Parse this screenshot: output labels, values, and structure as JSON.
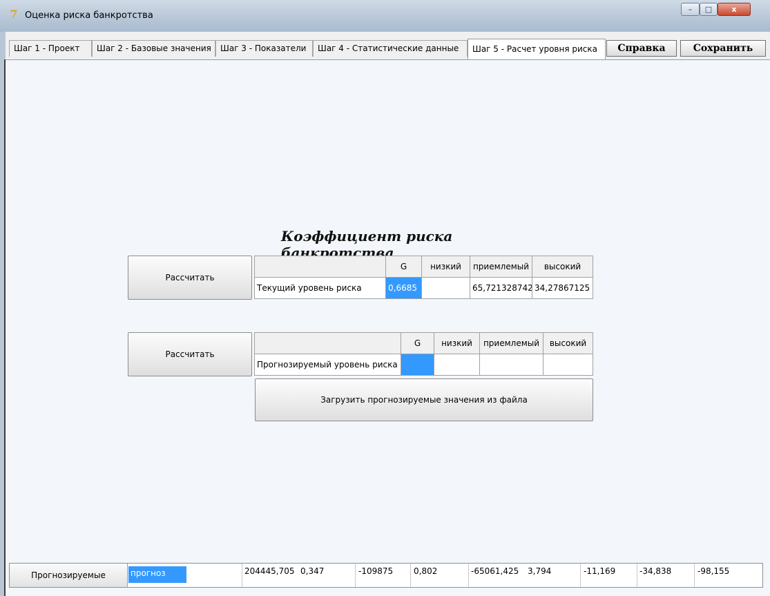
{
  "window": {
    "title": "Оценка риска банкротства",
    "icon": "app-logo-icon",
    "controls": {
      "minimize": "–",
      "maximize": "□",
      "close": "x"
    }
  },
  "tabs": [
    {
      "label": "Шаг 1 - Проект",
      "active": false
    },
    {
      "label": "Шаг 2 - Базовые значения",
      "active": false
    },
    {
      "label": "Шаг 3 - Показатели",
      "active": false
    },
    {
      "label": "Шаг 4 - Статистические данные",
      "active": false
    },
    {
      "label": "Шаг 5 - Расчет уровня риска",
      "active": true
    }
  ],
  "toolbar": {
    "help_label": "Справка",
    "save_label": "Сохранить"
  },
  "main": {
    "heading": "Коэффициент риска банкротства",
    "current": {
      "calc_label": "Рассчитать",
      "headers": [
        "",
        "G",
        "низкий",
        "приемлемый",
        "высокий"
      ],
      "row": [
        "Текущий уровень риска",
        "0,6685",
        "",
        "65,721328742",
        "34,27867125"
      ]
    },
    "forecast": {
      "calc_label": "Рассчитать",
      "headers": [
        "",
        "G",
        "низкий",
        "приемлемый",
        "высокий"
      ],
      "row": [
        "Прогнозируемый уровень риска",
        "",
        "",
        "",
        ""
      ],
      "load_label": "Загрузить прогнозируемые значения из файла"
    }
  },
  "bottom": {
    "label": "Прогнозируемые",
    "cells": [
      "прогноз",
      "204445,705",
      "0,347",
      "-109875",
      "0,802",
      "-65061,425",
      "3,794",
      "-11,169",
      "-34,838",
      "-98,155"
    ]
  },
  "colors": {
    "selection": "#3399ff",
    "content_bg": "#f3f6fa"
  }
}
